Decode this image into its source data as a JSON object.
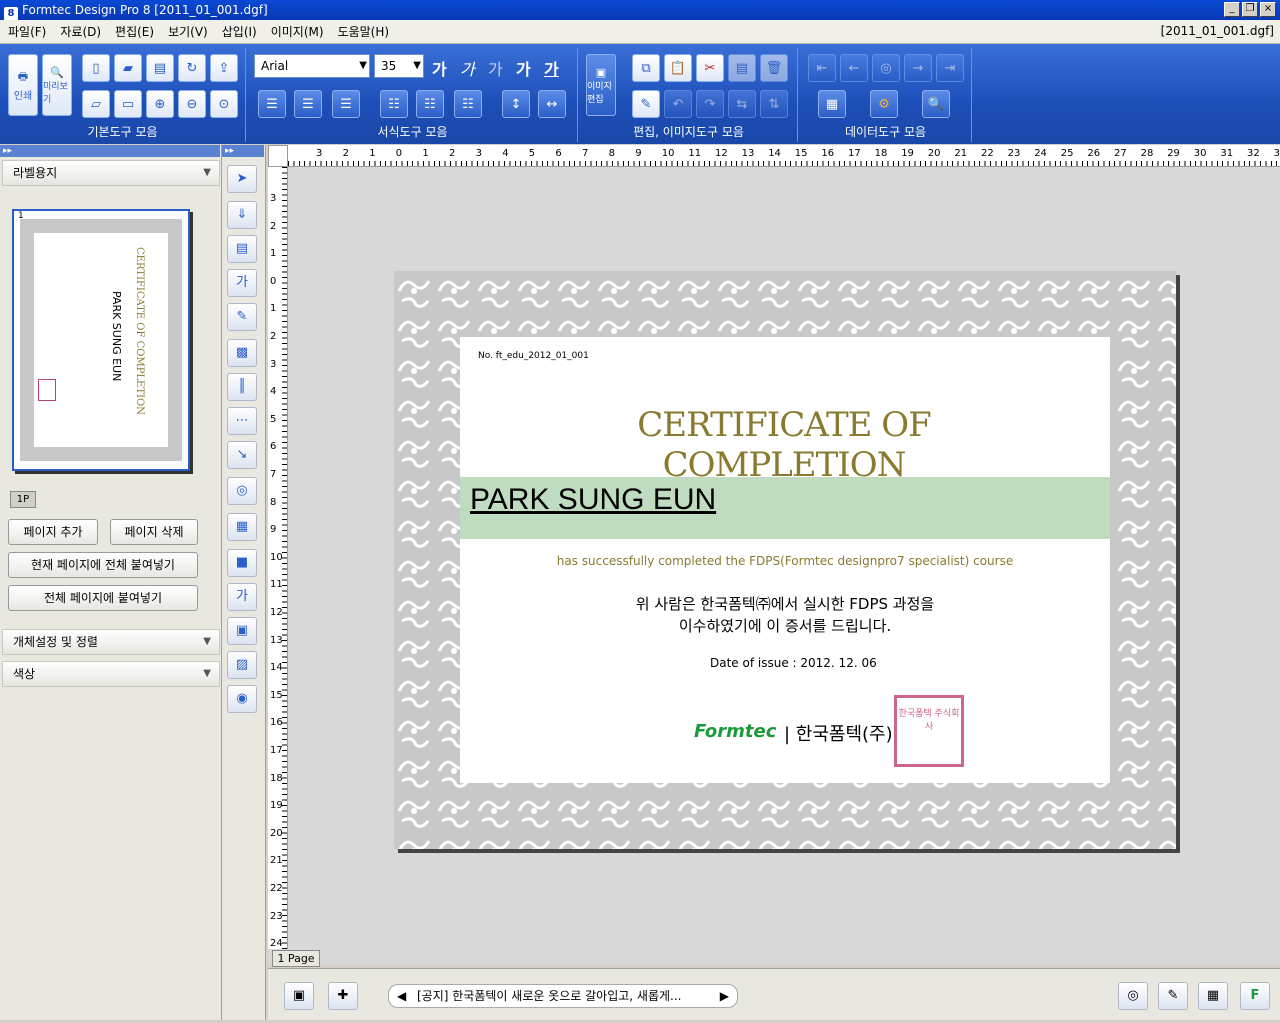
{
  "window": {
    "title": "Formtec Design Pro 8 [2011_01_001.dgf]",
    "minimize": "_",
    "restore": "❐",
    "close": "×"
  },
  "menu": {
    "items": [
      "파일(F)",
      "자료(D)",
      "편집(E)",
      "보기(V)",
      "삽입(I)",
      "이미지(M)",
      "도움말(H)"
    ],
    "doc_name": "[2011_01_001.dgf]"
  },
  "toolbar": {
    "groups": {
      "basic": "기본도구 모음",
      "format": "서식도구 모음",
      "edit": "편집, 이미지도구 모음",
      "data": "데이터도구 모음"
    },
    "print_label": "인쇄",
    "preview_label": "미리보기",
    "image_edit_label": "이미지편집",
    "font_name": "Arial",
    "font_size": "35",
    "kor_styles": [
      "가",
      "가",
      "가",
      "가",
      "가"
    ]
  },
  "left_panel": {
    "header": "라벨용지",
    "page_thumb_number": "1",
    "page_tab": "1P",
    "buttons": {
      "add_page": "페이지 추가",
      "delete_page": "페이지 삭제",
      "paste_all_current": "현재 페이지에 전체 붙여넣기",
      "paste_all_pages": "전체 페이지에 붙여넣기"
    },
    "object_settings": "개체설정 및 정렬",
    "color": "색상",
    "thumb_title": "CERTIFICATE OF COMPLETION",
    "thumb_name": "PARK SUNG EUN"
  },
  "ruler": {
    "h": [
      "3",
      "2",
      "1",
      "0",
      "1",
      "2",
      "3",
      "4",
      "5",
      "6",
      "7",
      "8",
      "9",
      "10",
      "11",
      "12",
      "13",
      "14",
      "15",
      "16",
      "17",
      "18",
      "19",
      "20",
      "21",
      "22",
      "23",
      "24",
      "25",
      "26",
      "27",
      "28",
      "29",
      "30",
      "31",
      "32",
      "33"
    ],
    "v": [
      "3",
      "2",
      "1",
      "0",
      "1",
      "2",
      "3",
      "4",
      "5",
      "6",
      "7",
      "8",
      "9",
      "10",
      "11",
      "12",
      "13",
      "14",
      "15",
      "16",
      "17",
      "18",
      "19",
      "20",
      "21",
      "22",
      "23",
      "24"
    ]
  },
  "certificate": {
    "serial": "No. ft_edu_2012_01_001",
    "title": "CERTIFICATE OF COMPLETION",
    "name": "PARK SUNG EUN",
    "course": "has successfully completed the FDPS(Formtec designpro7 specialist) course",
    "korean_line1": "위 사람은 한국폼텍㈜에서 실시한 FDPS 과정을",
    "korean_line2": "이수하였기에 이 증서를 드립니다.",
    "date_label": "Date of issue :",
    "date_value": "2012. 12. 06",
    "logo": "Formtec",
    "company": "| 한국폼텍(주)",
    "seal": "한국폼텍 주식회사"
  },
  "page_tab": "1 Page",
  "statusbar": {
    "notice": "[공지] 한국폼텍이 새로운 옷으로 갈아입고, 새롭게...",
    "prev": "◀",
    "next": "▶"
  }
}
